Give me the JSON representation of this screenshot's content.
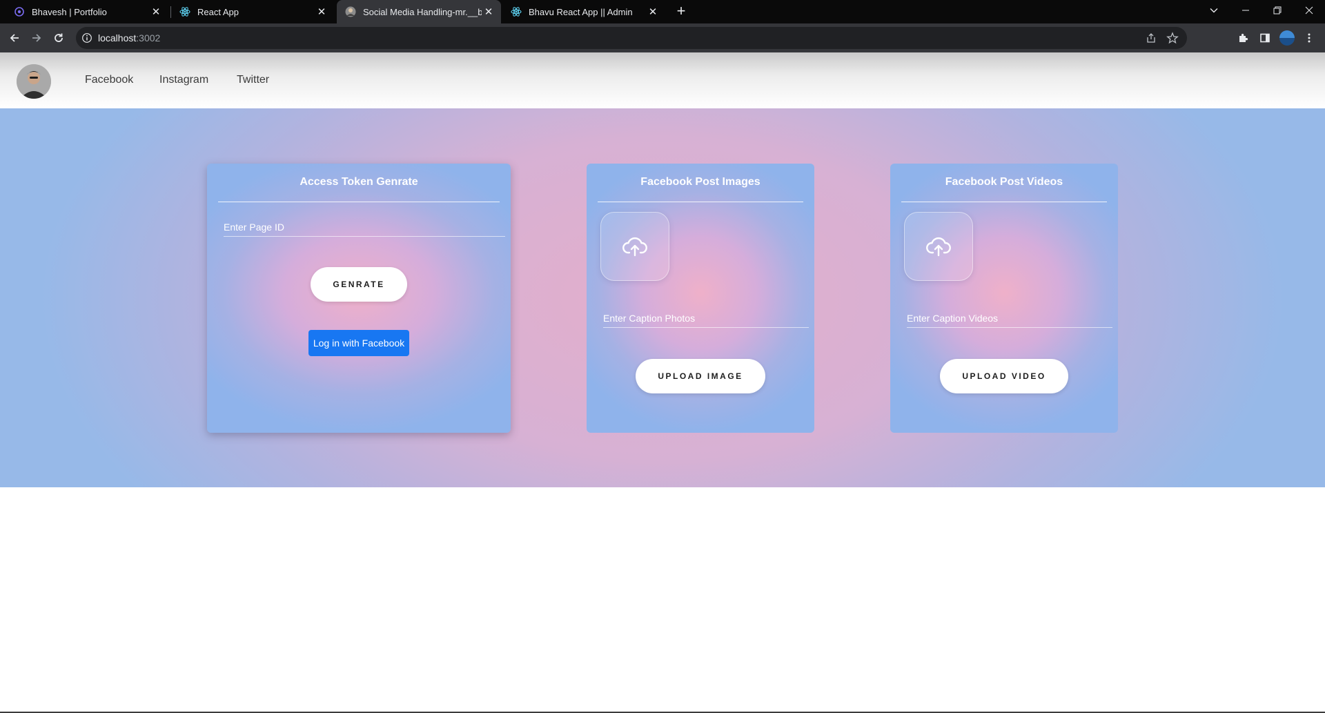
{
  "browser": {
    "tabs": [
      {
        "title": "Bhavesh | Portfolio",
        "icon": "portfolio-favicon",
        "active": false
      },
      {
        "title": "React App",
        "icon": "react-favicon",
        "active": false
      },
      {
        "title": "Social Media Handling-mr.__bha",
        "icon": "profile-favicon",
        "active": true
      },
      {
        "title": "Bhavu React App || Admin",
        "icon": "react-favicon",
        "active": false
      }
    ],
    "new_tab_label": "+",
    "close_glyph": "✕",
    "url_host": "localhost",
    "url_port": ":3002"
  },
  "header": {
    "nav": [
      "Facebook",
      "Instagram",
      "Twitter"
    ]
  },
  "cards": {
    "token": {
      "title": "Access Token Genrate",
      "placeholder": "Enter Page ID",
      "button": "GENRATE",
      "fb_button": "Log in with Facebook"
    },
    "images": {
      "title": "Facebook Post Images",
      "placeholder": "Enter Caption Photos",
      "button": "UPLOAD IMAGE",
      "icon": "cloud-upload-icon"
    },
    "videos": {
      "title": "Facebook Post Videos",
      "placeholder": "Enter Caption Videos",
      "button": "UPLOAD VIDEO",
      "icon": "cloud-upload-icon"
    }
  },
  "colors": {
    "facebook_blue": "#1877f2",
    "chrome_dark": "#35363a",
    "tab_strip": "#0a0a0a"
  }
}
